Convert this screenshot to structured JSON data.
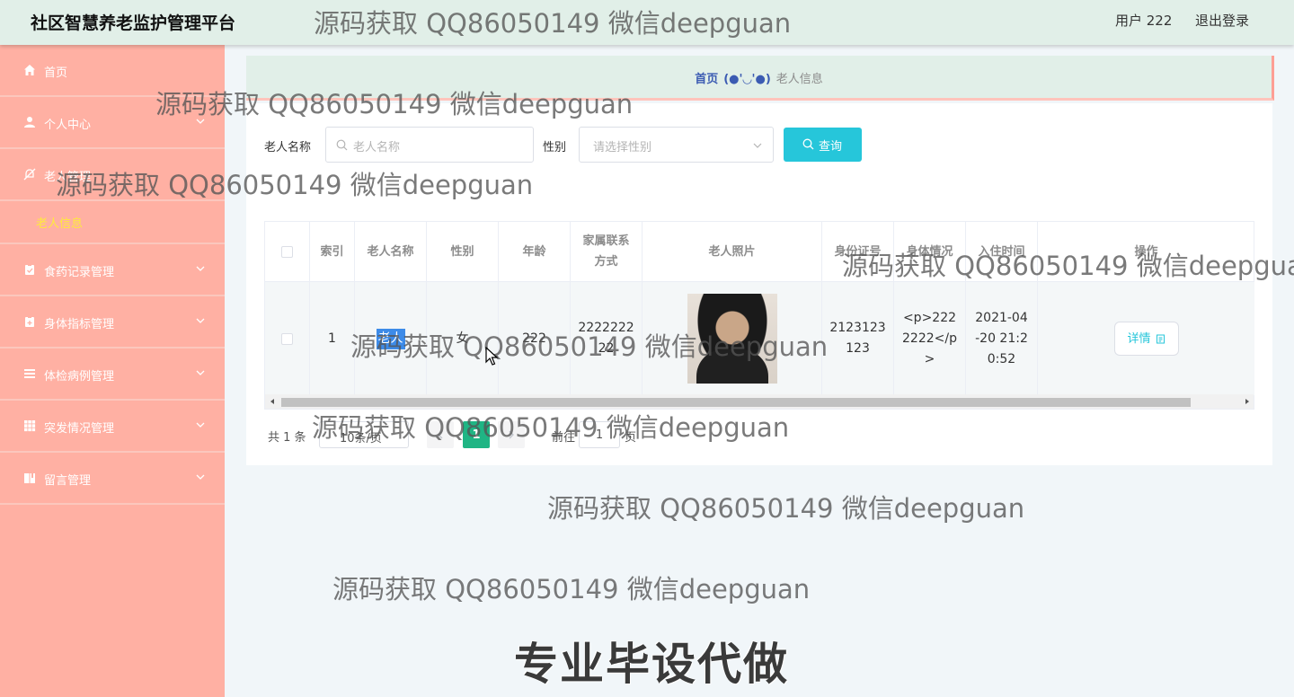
{
  "header": {
    "title": "社区智慧养老监护管理平台",
    "user": "用户 222",
    "logout": "退出登录"
  },
  "sidebar": {
    "items": [
      {
        "label": "首页",
        "icon": "home-icon"
      },
      {
        "label": "个人中心",
        "icon": "user-icon"
      },
      {
        "label": "老人管理",
        "icon": "bell-off-icon"
      },
      {
        "label": "食药记录管理",
        "icon": "clipboard-icon"
      },
      {
        "label": "身体指标管理",
        "icon": "clipboard-icon"
      },
      {
        "label": "体检病例管理",
        "icon": "list-icon"
      },
      {
        "label": "突发情况管理",
        "icon": "grid-icon"
      },
      {
        "label": "留言管理",
        "icon": "book-icon"
      }
    ],
    "sub_active": "老人信息"
  },
  "breadcrumb": {
    "home": "首页",
    "separator": "(●'◡'●)",
    "current": "老人信息"
  },
  "search": {
    "name_label": "老人名称",
    "name_placeholder": "老人名称",
    "gender_label": "性别",
    "gender_placeholder": "请选择性别",
    "button": "查询"
  },
  "table": {
    "headers": [
      "索引",
      "老人名称",
      "性别",
      "年龄",
      "家属联系方式",
      "老人照片",
      "身份证号",
      "身体情况",
      "入住时间",
      "操作"
    ],
    "rows": [
      {
        "index": "1",
        "name": "老人",
        "gender": "女",
        "age": "222",
        "contact": "2222222 22",
        "id_number": "2123123 123",
        "condition": "<p>222 2222</p >",
        "checkin": "2021-04 -20 21:2 0:52",
        "action": "详情"
      }
    ]
  },
  "pagination": {
    "total": "共 1 条",
    "page_size": "10条/页",
    "current": "1",
    "goto_label": "前往",
    "goto_value": "1",
    "page_suffix": "页"
  },
  "watermarks": {
    "text": "源码获取 QQ86050149 微信deepguan",
    "big": "专业毕设代做"
  },
  "colors": {
    "sidebar": "#ffb0a3",
    "header": "#e1efe8",
    "accent": "#26c6da",
    "active_page": "#1fb584",
    "active_sub": "#ffeb3b"
  }
}
